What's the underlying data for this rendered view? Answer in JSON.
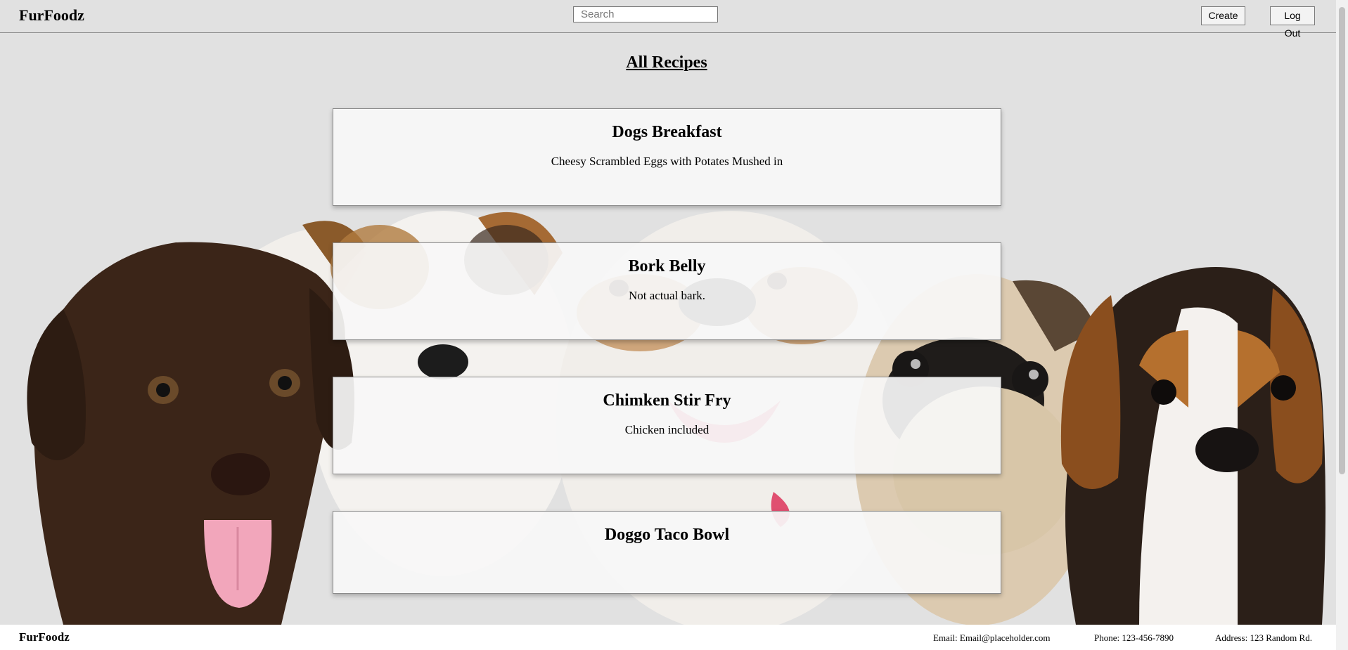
{
  "header": {
    "brand": "FurFoodz",
    "search_placeholder": "Search",
    "create_label": "Create",
    "logout_label": "Log Out"
  },
  "page": {
    "title": "All Recipes"
  },
  "recipes": [
    {
      "title": "Dogs Breakfast",
      "description": "Cheesy Scrambled Eggs with Potates Mushed in"
    },
    {
      "title": "Bork Belly",
      "description": "Not actual bark."
    },
    {
      "title": "Chimken Stir Fry",
      "description": "Chicken included"
    },
    {
      "title": "Doggo Taco Bowl",
      "description": ""
    }
  ],
  "footer": {
    "brand": "FurFoodz",
    "email": "Email: Email@placeholder.com",
    "phone": "Phone: 123-456-7890",
    "address": "Address: 123 Random Rd."
  },
  "colors": {
    "background": "#e1e1e1",
    "card": "#f7f7f7",
    "footer": "#ffffff"
  },
  "background_image": "puppies-row"
}
